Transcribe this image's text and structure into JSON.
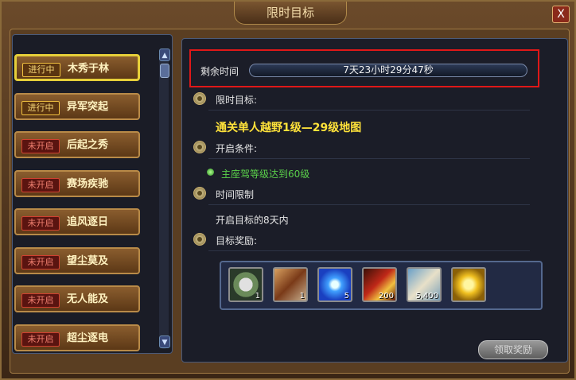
{
  "window": {
    "title": "限时目标",
    "close_label": "X"
  },
  "task_list": [
    {
      "status": "进行中",
      "status_kind": "active",
      "label": "木秀于林",
      "selected": true
    },
    {
      "status": "进行中",
      "status_kind": "active",
      "label": "异军突起",
      "selected": false
    },
    {
      "status": "未开启",
      "status_kind": "locked",
      "label": "后起之秀",
      "selected": false
    },
    {
      "status": "未开启",
      "status_kind": "locked",
      "label": "赛场疾驰",
      "selected": false
    },
    {
      "status": "未开启",
      "status_kind": "locked",
      "label": "追风逐日",
      "selected": false
    },
    {
      "status": "未开启",
      "status_kind": "locked",
      "label": "望尘莫及",
      "selected": false
    },
    {
      "status": "未开启",
      "status_kind": "locked",
      "label": "无人能及",
      "selected": false
    },
    {
      "status": "未开启",
      "status_kind": "locked",
      "label": "超尘逐电",
      "selected": false
    }
  ],
  "detail": {
    "remaining_label": "剩余时间",
    "remaining_value": "7天23小时29分47秒",
    "goal_heading": "限时目标:",
    "goal_text": "通关单人越野1级—29级地图",
    "condition_heading": "开启条件:",
    "condition_text": "主座驾等级达到60级",
    "limit_heading": "时间限制",
    "limit_text": "开启目标的8天内",
    "reward_heading": "目标奖励:"
  },
  "rewards": [
    {
      "icon": "gear-medal-icon",
      "qty": "1"
    },
    {
      "icon": "character-card-icon",
      "qty": "1"
    },
    {
      "icon": "blue-diamond-icon",
      "qty": "5"
    },
    {
      "icon": "red-boost-icon",
      "qty": "200"
    },
    {
      "icon": "scroll-icon",
      "qty": "5,400"
    },
    {
      "icon": "gold-coin-icon",
      "qty": ""
    }
  ],
  "claim_button": "领取奖励",
  "colors": {
    "goal": "#ffe23a",
    "condition": "#5ad04a",
    "highlight_box": "#e01818"
  }
}
